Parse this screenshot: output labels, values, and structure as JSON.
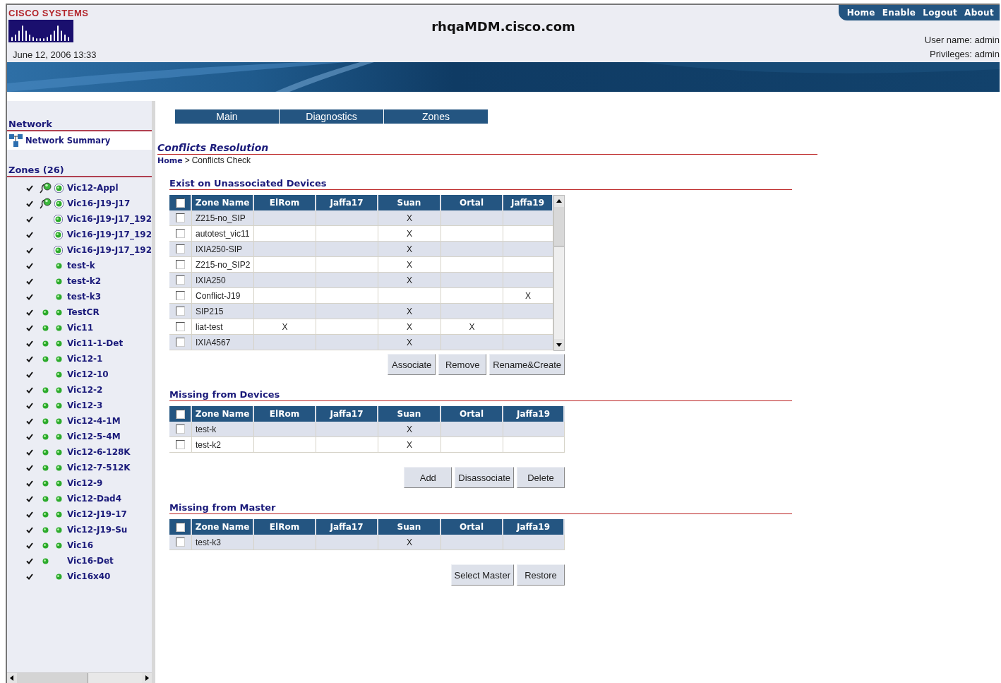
{
  "header": {
    "logo_text": "CISCO SYSTEMS",
    "date": "June 12, 2006 13:33",
    "host": "rhqaMDM.cisco.com",
    "top_links": [
      "Home",
      "Enable",
      "Logout",
      "About"
    ],
    "user_name": "User name: admin",
    "privileges": "Privileges: admin"
  },
  "sidebar": {
    "network_title": "Network",
    "network_items": [
      {
        "label": "Network Summary",
        "selected": true
      }
    ],
    "zones_title": "Zones (26)",
    "zones": [
      {
        "label": "Vic12-Appl",
        "checked": true,
        "kind": "linked"
      },
      {
        "label": "Vic16-J19-J17",
        "checked": true,
        "kind": "linked"
      },
      {
        "label": "Vic16-J19-J17_192",
        "checked": true,
        "kind": "ringed"
      },
      {
        "label": "Vic16-J19-J17_192",
        "checked": true,
        "kind": "ringed"
      },
      {
        "label": "Vic16-J19-J17_192",
        "checked": true,
        "kind": "ringed"
      },
      {
        "label": "test-k",
        "checked": true,
        "kind": "single"
      },
      {
        "label": "test-k2",
        "checked": true,
        "kind": "single"
      },
      {
        "label": "test-k3",
        "checked": true,
        "kind": "single"
      },
      {
        "label": "TestCR",
        "checked": true,
        "kind": "paired"
      },
      {
        "label": "Vic11",
        "checked": true,
        "kind": "paired"
      },
      {
        "label": "Vic11-1-Det",
        "checked": true,
        "kind": "paired"
      },
      {
        "label": "Vic12-1",
        "checked": true,
        "kind": "paired"
      },
      {
        "label": "Vic12-10",
        "checked": true,
        "kind": "single"
      },
      {
        "label": "Vic12-2",
        "checked": true,
        "kind": "paired"
      },
      {
        "label": "Vic12-3",
        "checked": true,
        "kind": "paired"
      },
      {
        "label": "Vic12-4-1M",
        "checked": true,
        "kind": "paired"
      },
      {
        "label": "Vic12-5-4M",
        "checked": true,
        "kind": "paired"
      },
      {
        "label": "Vic12-6-128K",
        "checked": true,
        "kind": "paired"
      },
      {
        "label": "Vic12-7-512K",
        "checked": true,
        "kind": "paired"
      },
      {
        "label": "Vic12-9",
        "checked": true,
        "kind": "paired"
      },
      {
        "label": "Vic12-Dad4",
        "checked": true,
        "kind": "paired"
      },
      {
        "label": "Vic12-J19-17",
        "checked": true,
        "kind": "paired"
      },
      {
        "label": "Vic12-J19-Su",
        "checked": true,
        "kind": "paired"
      },
      {
        "label": "Vic16",
        "checked": true,
        "kind": "paired"
      },
      {
        "label": "Vic16-Det",
        "checked": true,
        "kind": "detached"
      },
      {
        "label": "Vic16x40",
        "checked": true,
        "kind": "single"
      }
    ]
  },
  "tabs": [
    {
      "label": "Main",
      "selected": false
    },
    {
      "label": "Diagnostics",
      "selected": false
    },
    {
      "label": "Zones",
      "selected": false
    }
  ],
  "page_title": "Conflicts Resolution",
  "breadcrumb": {
    "home": "Home",
    "separator": ">",
    "current": "Conflicts Check"
  },
  "sections": [
    {
      "title": "Exist on Unassociated Devices",
      "scrollable": true,
      "header_checked": false,
      "columns": [
        "Zone Name",
        "ElRom",
        "Jaffa17",
        "Suan",
        "Ortal",
        "Jaffa19"
      ],
      "rows": [
        {
          "checked": false,
          "cells": [
            "Z215-no_SIP",
            "",
            "",
            "X",
            "",
            ""
          ]
        },
        {
          "checked": false,
          "cells": [
            "autotest_vic11",
            "",
            "",
            "X",
            "",
            ""
          ]
        },
        {
          "checked": false,
          "cells": [
            "IXIA250-SIP",
            "",
            "",
            "X",
            "",
            ""
          ]
        },
        {
          "checked": false,
          "cells": [
            "Z215-no_SIP2",
            "",
            "",
            "X",
            "",
            ""
          ]
        },
        {
          "checked": false,
          "cells": [
            "IXIA250",
            "",
            "",
            "X",
            "",
            ""
          ]
        },
        {
          "checked": false,
          "cells": [
            "Conflict-J19",
            "",
            "",
            "",
            "",
            "X"
          ]
        },
        {
          "checked": false,
          "cells": [
            "SIP215",
            "",
            "",
            "X",
            "",
            ""
          ]
        },
        {
          "checked": false,
          "cells": [
            "liat-test",
            "X",
            "",
            "X",
            "X",
            ""
          ]
        },
        {
          "checked": false,
          "cells": [
            "IXIA4567",
            "",
            "",
            "X",
            "",
            ""
          ]
        }
      ],
      "buttons": [
        "Associate",
        "Remove",
        "Rename&Create"
      ]
    },
    {
      "title": "Missing from Devices",
      "scrollable": false,
      "header_checked": false,
      "columns": [
        "Zone Name",
        "ElRom",
        "Jaffa17",
        "Suan",
        "Ortal",
        "Jaffa19"
      ],
      "rows": [
        {
          "checked": false,
          "cells": [
            "test-k",
            "",
            "",
            "X",
            "",
            ""
          ]
        },
        {
          "checked": false,
          "cells": [
            "test-k2",
            "",
            "",
            "X",
            "",
            ""
          ]
        }
      ],
      "buttons": [
        "Add",
        "Disassociate",
        "Delete"
      ]
    },
    {
      "title": "Missing from Master",
      "scrollable": false,
      "header_checked": false,
      "columns": [
        "Zone Name",
        "ElRom",
        "Jaffa17",
        "Suan",
        "Ortal",
        "Jaffa19"
      ],
      "rows": [
        {
          "checked": false,
          "cells": [
            "test-k3",
            "",
            "",
            "X",
            "",
            ""
          ]
        }
      ],
      "buttons": [
        "Select Master",
        "Restore"
      ]
    }
  ]
}
